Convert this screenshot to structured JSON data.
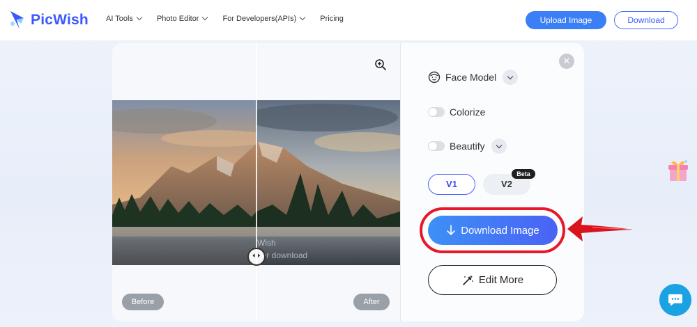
{
  "header": {
    "logo_text": "PicWish",
    "nav": [
      {
        "label": "AI Tools",
        "has_chevron": true
      },
      {
        "label": "Photo Editor",
        "has_chevron": true
      },
      {
        "label": "For Developers(APIs)",
        "has_chevron": true
      },
      {
        "label": "Pricing",
        "has_chevron": false
      }
    ],
    "upload_label": "Upload Image",
    "download_label": "Download"
  },
  "preview": {
    "before_label": "Before",
    "after_label": "After",
    "watermark_line1": "Wish",
    "watermark_line2": "fter download"
  },
  "options": {
    "face_model_label": "Face Model",
    "colorize_label": "Colorize",
    "beautify_label": "Beautify",
    "v1_label": "V1",
    "v2_label": "V2",
    "beta_label": "Beta",
    "download_image_label": "Download Image",
    "edit_more_label": "Edit More"
  },
  "colors": {
    "brand": "#3b57ff",
    "accent_button": "#3b7ff6",
    "highlight_ring": "#e8182b",
    "chat": "#1aa2e3"
  },
  "icons": [
    "logo-mark-icon",
    "chevron-down-icon",
    "zoom-in-icon",
    "close-icon",
    "face-icon",
    "download-arrow-icon",
    "magic-wand-icon",
    "gift-icon",
    "chat-icon",
    "slider-handle-icon"
  ]
}
